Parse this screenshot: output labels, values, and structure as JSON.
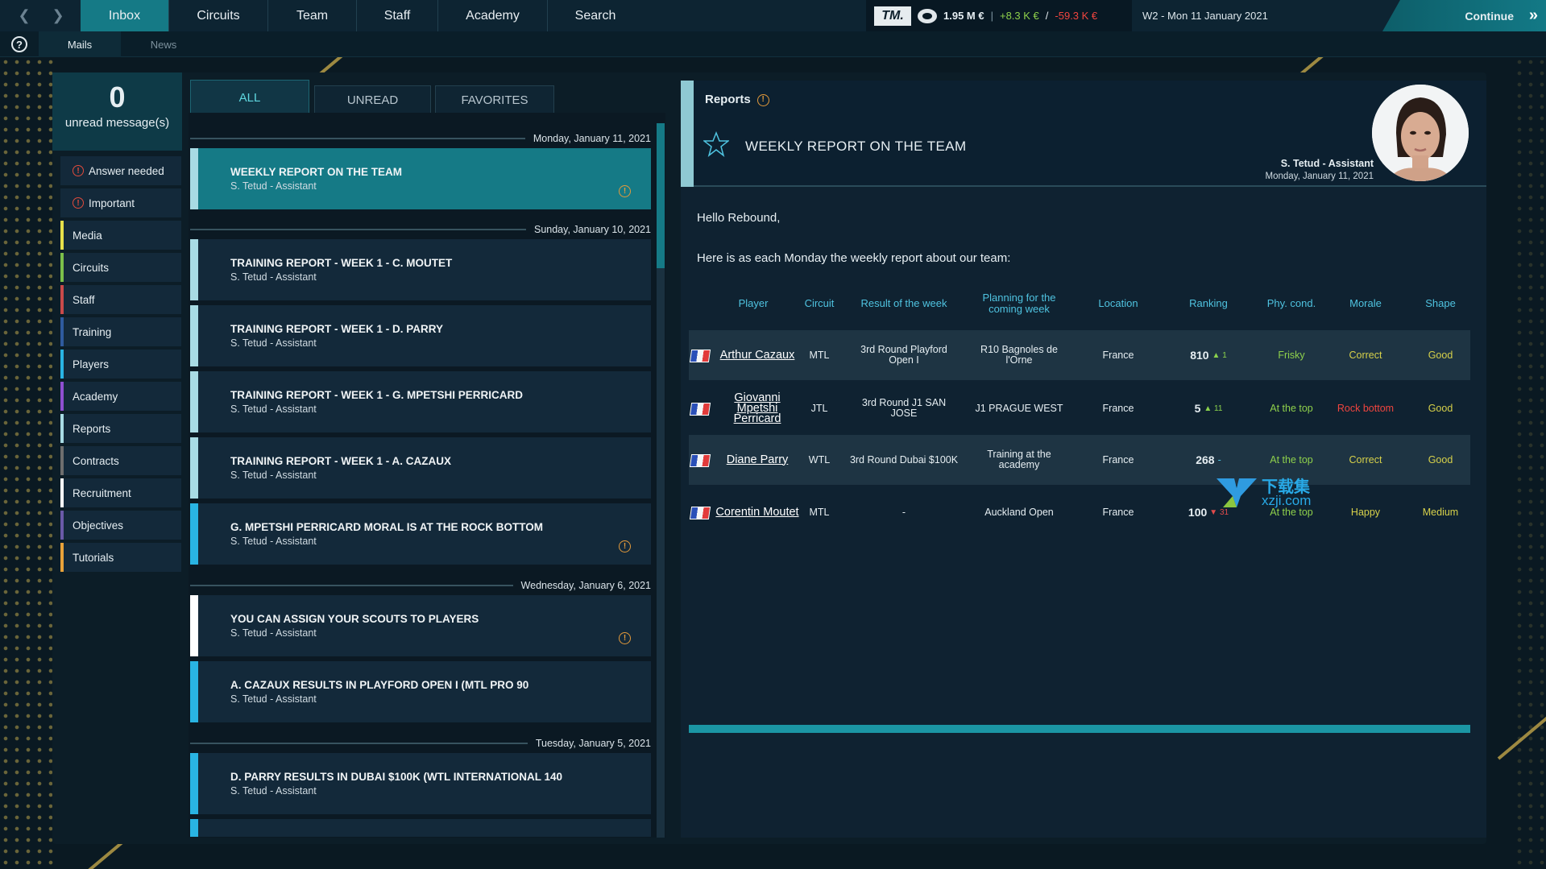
{
  "topbar": {
    "tabs": [
      {
        "label": "Inbox",
        "active": true
      },
      {
        "label": "Circuits"
      },
      {
        "label": "Team"
      },
      {
        "label": "Staff"
      },
      {
        "label": "Academy"
      },
      {
        "label": "Search"
      }
    ],
    "logo": "TM.",
    "balance": "1.95 M €",
    "separator": "|",
    "income": "+8.3 K €",
    "slash": "/",
    "expense": "-59.3 K €",
    "date": "W2 - Mon 11 January 2021",
    "continue_label": "Continue"
  },
  "subnav": {
    "mails": "Mails",
    "news": "News",
    "help": "?"
  },
  "sidebar": {
    "unread_count": "0",
    "unread_label": "unread message(s)",
    "categories": [
      {
        "label": "Answer needed",
        "icon": "warning-icon"
      },
      {
        "label": "Important",
        "icon": "warning-icon"
      },
      {
        "label": "Media",
        "color": "#e6e04a"
      },
      {
        "label": "Circuits",
        "color": "#7bbf4a"
      },
      {
        "label": "Staff",
        "color": "#c94a4a"
      },
      {
        "label": "Training",
        "color": "#2f5b9e"
      },
      {
        "label": "Players",
        "color": "#29b4e3"
      },
      {
        "label": "Academy",
        "color": "#8e4fd1"
      },
      {
        "label": "Reports",
        "color": "#a8dbe4"
      },
      {
        "label": "Contracts",
        "color": "#6e6e6e"
      },
      {
        "label": "Recruitment",
        "color": "#ffffff"
      },
      {
        "label": "Objectives",
        "color": "#6a5aa8"
      },
      {
        "label": "Tutorials",
        "color": "#e8a23a"
      }
    ]
  },
  "filters": [
    "ALL",
    "UNREAD",
    "FAVORITES"
  ],
  "mail_list": {
    "dates": [
      "Monday, January 11, 2021",
      "Sunday, January 10, 2021",
      "Wednesday, January 6, 2021",
      "Tuesday, January 5, 2021"
    ],
    "mails": [
      {
        "title": "WEEKLY REPORT ON THE TEAM",
        "sender": "S. Tetud - Assistant"
      },
      {
        "title": "TRAINING REPORT - WEEK 1 - C. MOUTET",
        "sender": "S. Tetud - Assistant"
      },
      {
        "title": "TRAINING REPORT - WEEK 1 - D. PARRY",
        "sender": "S. Tetud - Assistant"
      },
      {
        "title": "TRAINING REPORT - WEEK 1 - G. MPETSHI PERRICARD",
        "sender": "S. Tetud - Assistant"
      },
      {
        "title": "TRAINING REPORT - WEEK 1 - A. CAZAUX",
        "sender": "S. Tetud - Assistant"
      },
      {
        "title": "G. MPETSHI PERRICARD MORAL IS AT THE ROCK BOTTOM",
        "sender": "S. Tetud - Assistant"
      },
      {
        "title": "YOU CAN ASSIGN YOUR SCOUTS TO PLAYERS",
        "sender": "S. Tetud - Assistant"
      },
      {
        "title": "A. CAZAUX RESULTS IN PLAYFORD OPEN I (MTL PRO 90",
        "sender": "S. Tetud - Assistant"
      },
      {
        "title": "D. PARRY RESULTS IN DUBAI $100K (WTL INTERNATIONAL 140",
        "sender": "S. Tetud - Assistant"
      }
    ],
    "alert_glyph": "!"
  },
  "reader": {
    "category": "Reports",
    "subject": "WEEKLY REPORT ON THE TEAM",
    "sender": "S. Tetud - Assistant",
    "date": "Monday, January 11, 2021",
    "greeting": "Hello Rebound,",
    "intro": "Here is as each Monday the weekly report about our team:",
    "columns": [
      "Player",
      "Circuit",
      "Result of the week",
      "Planning for the coming week",
      "Location",
      "Ranking",
      "Phy. cond.",
      "Morale",
      "Shape"
    ],
    "rows": [
      {
        "player": "Arthur Cazaux",
        "circuit": "MTL",
        "result": "3rd Round Playford Open I",
        "planning": "R10 Bagnoles de l'Orne",
        "location": "France",
        "rank": "810",
        "delta": "▲ 1",
        "phy": "Frisky",
        "morale": "Correct",
        "shape": "Good"
      },
      {
        "player": "Giovanni Mpetshi Perricard",
        "circuit": "JTL",
        "result": "3rd Round J1 SAN JOSE",
        "planning": "J1 PRAGUE WEST",
        "location": "France",
        "rank": "5",
        "delta": "▲ 11",
        "phy": "At the top",
        "morale": "Rock bottom",
        "shape": "Good"
      },
      {
        "player": "Diane Parry",
        "circuit": "WTL",
        "result": "3rd Round Dubai $100K",
        "planning": "Training at the academy",
        "location": "France",
        "rank": "268",
        "delta": "-",
        "phy": "At the top",
        "morale": "Correct",
        "shape": "Good"
      },
      {
        "player": "Corentin Moutet",
        "circuit": "MTL",
        "result": "-",
        "planning": "Auckland Open",
        "location": "France",
        "rank": "100",
        "delta": "▼ 31",
        "phy": "At the top",
        "morale": "Happy",
        "shape": "Medium"
      }
    ],
    "progress": 1.0
  },
  "watermark": {
    "cn": "下载集",
    "en": "xzji.com"
  },
  "colors": {
    "accent": "#157a86",
    "title_blue": "#4fc3e0",
    "good": "#8ed04b",
    "ok": "#d7d14a",
    "bad": "#f0453f"
  }
}
